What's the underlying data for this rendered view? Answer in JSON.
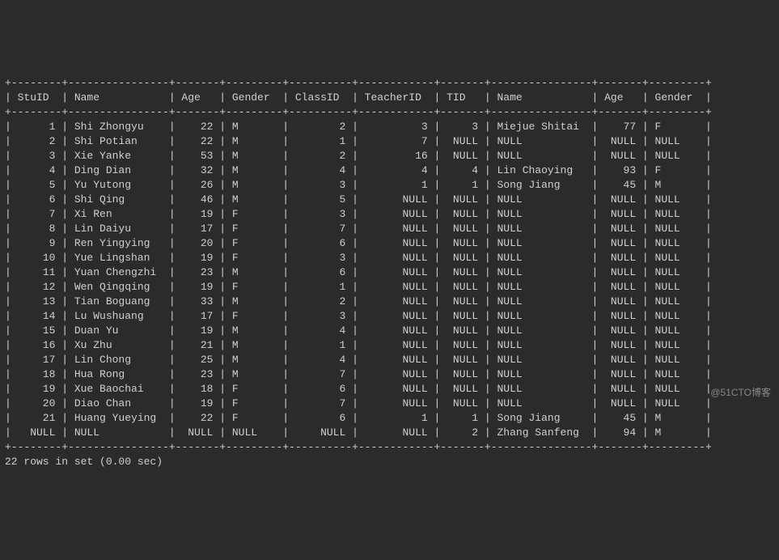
{
  "columns": [
    {
      "key": "StuID",
      "width": 6,
      "align": "right"
    },
    {
      "key": "Name",
      "width": 14,
      "align": "left"
    },
    {
      "key": "Age",
      "width": 5,
      "align": "right"
    },
    {
      "key": "Gender",
      "width": 7,
      "align": "left"
    },
    {
      "key": "ClassID",
      "width": 8,
      "align": "right"
    },
    {
      "key": "TeacherID",
      "width": 10,
      "align": "right"
    },
    {
      "key": "TID",
      "width": 5,
      "align": "right"
    },
    {
      "key": "Name",
      "width": 14,
      "align": "left"
    },
    {
      "key": "Age",
      "width": 5,
      "align": "right"
    },
    {
      "key": "Gender",
      "width": 7,
      "align": "left"
    }
  ],
  "rows": [
    [
      "1",
      "Shi Zhongyu",
      "22",
      "M",
      "2",
      "3",
      "3",
      "Miejue Shitai",
      "77",
      "F"
    ],
    [
      "2",
      "Shi Potian",
      "22",
      "M",
      "1",
      "7",
      "NULL",
      "NULL",
      "NULL",
      "NULL"
    ],
    [
      "3",
      "Xie Yanke",
      "53",
      "M",
      "2",
      "16",
      "NULL",
      "NULL",
      "NULL",
      "NULL"
    ],
    [
      "4",
      "Ding Dian",
      "32",
      "M",
      "4",
      "4",
      "4",
      "Lin Chaoying",
      "93",
      "F"
    ],
    [
      "5",
      "Yu Yutong",
      "26",
      "M",
      "3",
      "1",
      "1",
      "Song Jiang",
      "45",
      "M"
    ],
    [
      "6",
      "Shi Qing",
      "46",
      "M",
      "5",
      "NULL",
      "NULL",
      "NULL",
      "NULL",
      "NULL"
    ],
    [
      "7",
      "Xi Ren",
      "19",
      "F",
      "3",
      "NULL",
      "NULL",
      "NULL",
      "NULL",
      "NULL"
    ],
    [
      "8",
      "Lin Daiyu",
      "17",
      "F",
      "7",
      "NULL",
      "NULL",
      "NULL",
      "NULL",
      "NULL"
    ],
    [
      "9",
      "Ren Yingying",
      "20",
      "F",
      "6",
      "NULL",
      "NULL",
      "NULL",
      "NULL",
      "NULL"
    ],
    [
      "10",
      "Yue Lingshan",
      "19",
      "F",
      "3",
      "NULL",
      "NULL",
      "NULL",
      "NULL",
      "NULL"
    ],
    [
      "11",
      "Yuan Chengzhi",
      "23",
      "M",
      "6",
      "NULL",
      "NULL",
      "NULL",
      "NULL",
      "NULL"
    ],
    [
      "12",
      "Wen Qingqing",
      "19",
      "F",
      "1",
      "NULL",
      "NULL",
      "NULL",
      "NULL",
      "NULL"
    ],
    [
      "13",
      "Tian Boguang",
      "33",
      "M",
      "2",
      "NULL",
      "NULL",
      "NULL",
      "NULL",
      "NULL"
    ],
    [
      "14",
      "Lu Wushuang",
      "17",
      "F",
      "3",
      "NULL",
      "NULL",
      "NULL",
      "NULL",
      "NULL"
    ],
    [
      "15",
      "Duan Yu",
      "19",
      "M",
      "4",
      "NULL",
      "NULL",
      "NULL",
      "NULL",
      "NULL"
    ],
    [
      "16",
      "Xu Zhu",
      "21",
      "M",
      "1",
      "NULL",
      "NULL",
      "NULL",
      "NULL",
      "NULL"
    ],
    [
      "17",
      "Lin Chong",
      "25",
      "M",
      "4",
      "NULL",
      "NULL",
      "NULL",
      "NULL",
      "NULL"
    ],
    [
      "18",
      "Hua Rong",
      "23",
      "M",
      "7",
      "NULL",
      "NULL",
      "NULL",
      "NULL",
      "NULL"
    ],
    [
      "19",
      "Xue Baochai",
      "18",
      "F",
      "6",
      "NULL",
      "NULL",
      "NULL",
      "NULL",
      "NULL"
    ],
    [
      "20",
      "Diao Chan",
      "19",
      "F",
      "7",
      "NULL",
      "NULL",
      "NULL",
      "NULL",
      "NULL"
    ],
    [
      "21",
      "Huang Yueying",
      "22",
      "F",
      "6",
      "1",
      "1",
      "Song Jiang",
      "45",
      "M"
    ],
    [
      "NULL",
      "NULL",
      "NULL",
      "NULL",
      "NULL",
      "NULL",
      "2",
      "Zhang Sanfeng",
      "94",
      "M"
    ]
  ],
  "footer": "22 rows in set (0.00 sec)",
  "watermark": "@51CTO博客"
}
